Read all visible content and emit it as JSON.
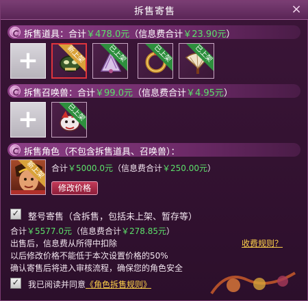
{
  "window": {
    "title": "拆售寄售",
    "close_label": "×"
  },
  "items_section": {
    "label": "拆售道具：合计",
    "total": "￥478.0元",
    "fee_prefix": "（信息费合计",
    "fee": "￥23.90元",
    "fee_suffix": "）",
    "slots": [
      {
        "badge": "新上架",
        "selected": true,
        "icon": "mask-item-icon"
      },
      {
        "badge": "已上架",
        "selected": false,
        "icon": "fan-item-icon"
      },
      {
        "badge": "已上架",
        "selected": false,
        "icon": "bracelet-item-icon"
      },
      {
        "badge": "已上架",
        "selected": false,
        "icon": "fan-weapon-icon"
      }
    ]
  },
  "pets_section": {
    "label": "拆售召唤兽：合计",
    "total": "￥99.0元",
    "fee_prefix": "（信息费合计",
    "fee": "￥4.95元",
    "fee_suffix": "）",
    "slot": {
      "badge": "已上架",
      "icon": "pet-icon"
    }
  },
  "role_section": {
    "label": "拆售角色（不包含拆售道具、召唤兽）：",
    "badge": "新上架",
    "sum_prefix": "合计",
    "total": "￥5000.0元",
    "fee_prefix": "（信息费合计",
    "fee": "￥250.00元",
    "fee_suffix": "）",
    "button": "修改价格"
  },
  "whole_sale": {
    "checkbox_mark": "✓",
    "label": "整号寄售（含拆售，包括未上架、暂存等）",
    "sum_prefix": "合计",
    "total": "￥5577.0元",
    "fee_prefix": "（信息费合计",
    "fee": "￥278.85元",
    "fee_suffix": "）"
  },
  "notes": {
    "line1": "出售后，信息费从所得中扣除",
    "line2": "以后修改价格不能低于本次设置价格的50%",
    "line3": "确认寄售后将进入审核流程，确保您的角色安全",
    "fee_rule_link": "收费规则？"
  },
  "agreement": {
    "checkbox_mark": "✓",
    "prefix": "我已阅读并同意",
    "link": "《角色拆售规则》"
  },
  "colors": {
    "accent_green": "#5ce06a",
    "link_yellow": "#ffd24a",
    "header_purple": "#8d3f86"
  }
}
